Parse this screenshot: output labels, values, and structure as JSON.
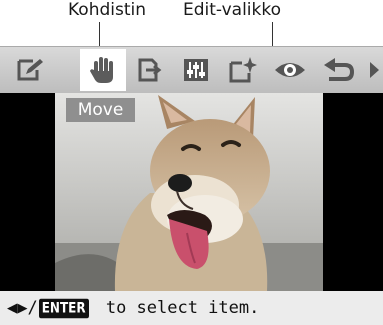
{
  "callouts": {
    "cursor_label": "Kohdistin",
    "menu_label": "Edit-valikko"
  },
  "toolbar": {
    "selected_icon": "hand-move-icon",
    "icons": [
      "pencil-edit-icon",
      "hand-move-icon",
      "rotate-icon",
      "adjust-sliders-icon",
      "frame-sparkle-icon",
      "eye-icon",
      "undo-icon",
      "scroll-right-arrow-icon"
    ]
  },
  "preview": {
    "mode_label": "Move"
  },
  "status": {
    "arrows": "◀▶/",
    "enter_key": "ENTER",
    "text": " to select item."
  },
  "colors": {
    "accent": "#ffffff",
    "toolbar_bg": "#cfcfcf",
    "status_bg": "#ececec",
    "mode_label_bg": "#8f8f8f"
  }
}
